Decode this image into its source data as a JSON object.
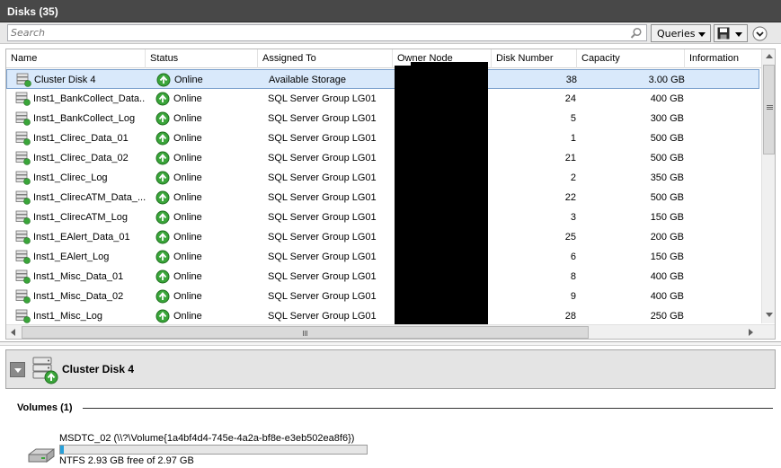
{
  "window": {
    "title": "Disks (35)"
  },
  "toolbar": {
    "search_placeholder": "Search",
    "queries_label": "Queries"
  },
  "columns": [
    "Name",
    "Status",
    "Assigned To",
    "Owner Node",
    "Disk Number",
    "Capacity",
    "Information"
  ],
  "rows": [
    {
      "name": "Cluster Disk 4",
      "status": "Online",
      "assigned_to": "Available Storage",
      "disk_number": "38",
      "capacity": "3.00 GB",
      "selected": true
    },
    {
      "name": "Inst1_BankCollect_Data...",
      "status": "Online",
      "assigned_to": "SQL Server Group LG01",
      "disk_number": "24",
      "capacity": "400 GB"
    },
    {
      "name": "Inst1_BankCollect_Log",
      "status": "Online",
      "assigned_to": "SQL Server Group LG01",
      "disk_number": "5",
      "capacity": "300 GB"
    },
    {
      "name": "Inst1_Clirec_Data_01",
      "status": "Online",
      "assigned_to": "SQL Server Group LG01",
      "disk_number": "1",
      "capacity": "500 GB"
    },
    {
      "name": "Inst1_Clirec_Data_02",
      "status": "Online",
      "assigned_to": "SQL Server Group LG01",
      "disk_number": "21",
      "capacity": "500 GB"
    },
    {
      "name": "Inst1_Clirec_Log",
      "status": "Online",
      "assigned_to": "SQL Server Group LG01",
      "disk_number": "2",
      "capacity": "350 GB"
    },
    {
      "name": "Inst1_ClirecATM_Data_...",
      "status": "Online",
      "assigned_to": "SQL Server Group LG01",
      "disk_number": "22",
      "capacity": "500 GB"
    },
    {
      "name": "Inst1_ClirecATM_Log",
      "status": "Online",
      "assigned_to": "SQL Server Group LG01",
      "disk_number": "3",
      "capacity": "150 GB"
    },
    {
      "name": "Inst1_EAlert_Data_01",
      "status": "Online",
      "assigned_to": "SQL Server Group LG01",
      "disk_number": "25",
      "capacity": "200 GB"
    },
    {
      "name": "Inst1_EAlert_Log",
      "status": "Online",
      "assigned_to": "SQL Server Group LG01",
      "disk_number": "6",
      "capacity": "150 GB"
    },
    {
      "name": "Inst1_Misc_Data_01",
      "status": "Online",
      "assigned_to": "SQL Server Group LG01",
      "disk_number": "8",
      "capacity": "400 GB"
    },
    {
      "name": "Inst1_Misc_Data_02",
      "status": "Online",
      "assigned_to": "SQL Server Group LG01",
      "disk_number": "9",
      "capacity": "400 GB"
    },
    {
      "name": "Inst1_Misc_Log",
      "status": "Online",
      "assigned_to": "SQL Server Group LG01",
      "disk_number": "28",
      "capacity": "250 GB"
    }
  ],
  "detail": {
    "title": "Cluster Disk 4",
    "volumes_label": "Volumes (1)",
    "volume": {
      "name": "MSDTC_02 (\\\\?\\Volume{1a4bf4d4-745e-4a2a-bf8e-e3eb502ea8f6})",
      "free_text": "NTFS 2.93 GB free of 2.97 GB",
      "used_fraction": 0.013
    }
  },
  "icons": {
    "disk": "cluster-disk-icon",
    "status": "online-status-icon",
    "search": "search-icon",
    "save": "save-icon",
    "collapse": "chevron-down-icon"
  },
  "colors": {
    "title_bar": "#484848",
    "selection": "#d9e9fb",
    "online_green": "#3aa53a",
    "usage_bar": "#26a0da"
  }
}
